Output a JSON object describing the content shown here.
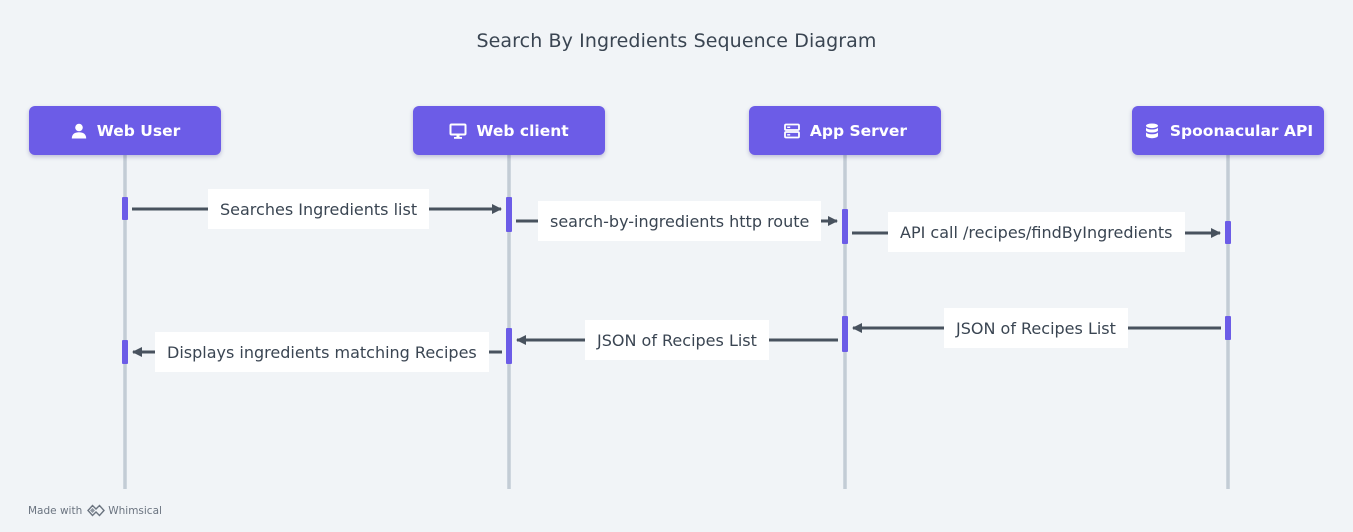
{
  "title": "Search By Ingredients Sequence Diagram",
  "colors": {
    "background": "#f1f4f7",
    "actor": "#6c5ce7",
    "activation": "#6c5ce7",
    "lifeline": "#c3ccd5",
    "arrow": "#48525e",
    "label_bg": "#ffffff",
    "text": "#3a4552"
  },
  "actors": [
    {
      "label": "Web User",
      "icon": "user-icon"
    },
    {
      "label": "Web client",
      "icon": "monitor-icon"
    },
    {
      "label": "App Server",
      "icon": "server-icon"
    },
    {
      "label": "Spoonacular API",
      "icon": "database-icon"
    }
  ],
  "messages": [
    {
      "label": "Searches Ingredients list",
      "from": 0,
      "to": 1
    },
    {
      "label": "search-by-ingredients http route",
      "from": 1,
      "to": 2
    },
    {
      "label": "API call /recipes/findByIngredients",
      "from": 2,
      "to": 3
    },
    {
      "label": "JSON of Recipes List",
      "from": 3,
      "to": 2
    },
    {
      "label": "JSON of Recipes List",
      "from": 2,
      "to": 1
    },
    {
      "label": "Displays ingredients matching Recipes",
      "from": 1,
      "to": 0
    }
  ],
  "footer": {
    "made_with": "Made with",
    "brand": "Whimsical",
    "brand_icon": "whimsical-logo-icon"
  }
}
